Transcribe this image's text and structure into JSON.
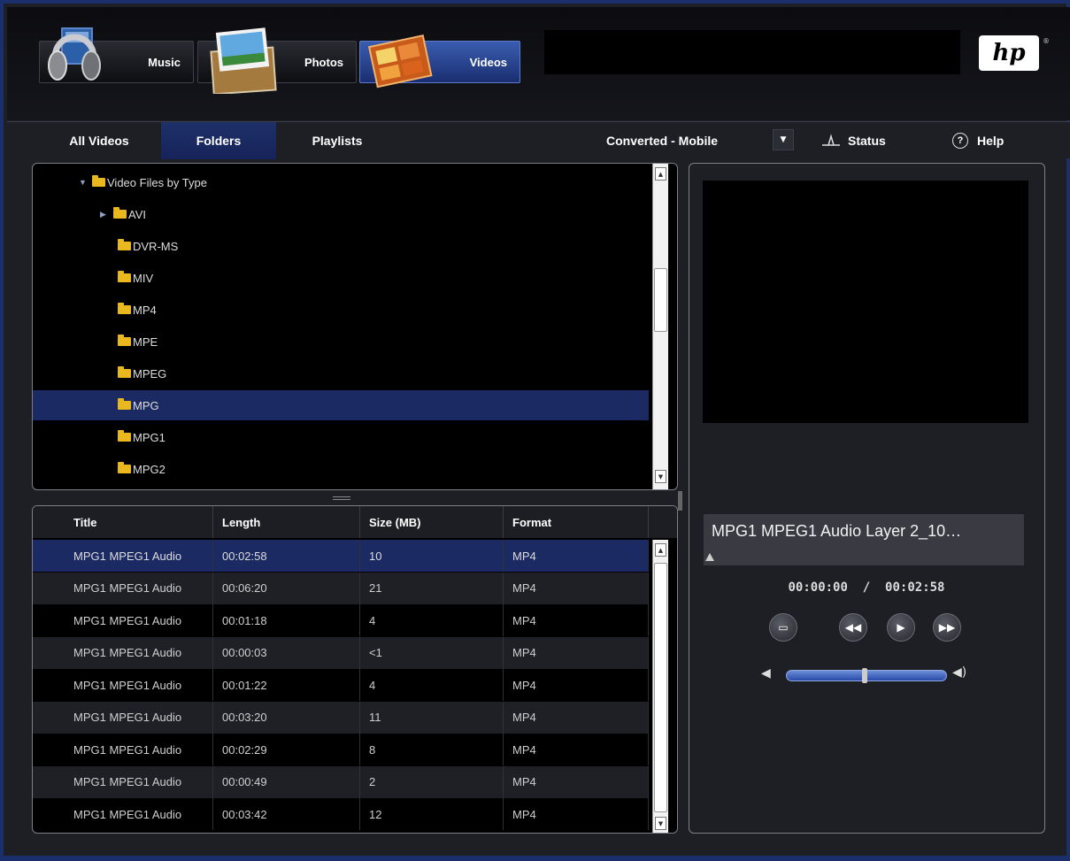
{
  "media_tabs": {
    "music": "Music",
    "photos": "Photos",
    "videos": "Videos"
  },
  "brand": "hp",
  "nav": {
    "tabs": [
      "All Videos",
      "Folders",
      "Playlists"
    ],
    "view_mode": "Converted - Mobile",
    "status": "Status",
    "help": "Help"
  },
  "tree": {
    "items": [
      {
        "label": "Video Files by Type",
        "expander": "▼"
      },
      {
        "label": "AVI",
        "expander": "▶"
      },
      {
        "label": "DVR-MS",
        "expander": ""
      },
      {
        "label": "MIV",
        "expander": ""
      },
      {
        "label": "MP4",
        "expander": ""
      },
      {
        "label": "MPE",
        "expander": ""
      },
      {
        "label": "MPEG",
        "expander": ""
      },
      {
        "label": "MPG",
        "expander": ""
      },
      {
        "label": "MPG1",
        "expander": ""
      },
      {
        "label": "MPG2",
        "expander": ""
      }
    ]
  },
  "table": {
    "headers": [
      "Title",
      "Length",
      "Size (MB)",
      "Format"
    ],
    "rows": [
      [
        "MPG1 MPEG1 Audio",
        "00:02:58",
        "10",
        "MP4"
      ],
      [
        "MPG1 MPEG1 Audio",
        "00:06:20",
        "21",
        "MP4"
      ],
      [
        "MPG1 MPEG1 Audio",
        "00:01:18",
        "4",
        "MP4"
      ],
      [
        "MPG1 MPEG1 Audio",
        "00:00:03",
        "<1",
        "MP4"
      ],
      [
        "MPG1 MPEG1 Audio",
        "00:01:22",
        "4",
        "MP4"
      ],
      [
        "MPG1 MPEG1 Audio",
        "00:03:20",
        "11",
        "MP4"
      ],
      [
        "MPG1 MPEG1 Audio",
        "00:02:29",
        "8",
        "MP4"
      ],
      [
        "MPG1 MPEG1 Audio",
        "00:00:49",
        "2",
        "MP4"
      ],
      [
        "MPG1 MPEG1 Audio",
        "00:03:42",
        "12",
        "MP4"
      ]
    ]
  },
  "player": {
    "title": "MPG1 MPEG1 Audio Layer 2_10…",
    "time": "00:00:00  /  00:02:58",
    "volume": 0.5
  },
  "colors": {
    "accent": "#1c2a63",
    "frame": "#1a2f6b",
    "folder": "#e9b81f"
  }
}
